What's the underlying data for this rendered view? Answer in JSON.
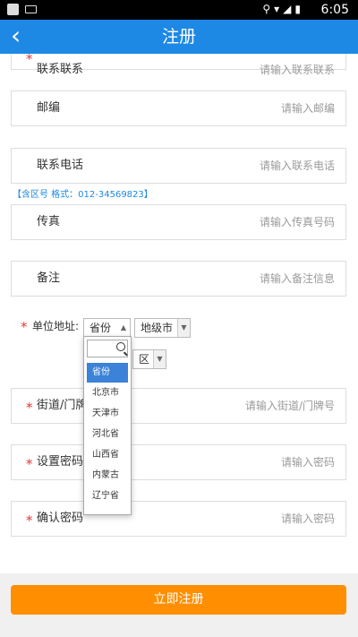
{
  "status_bar": {
    "time": "6:05"
  },
  "app_bar": {
    "back_icon": "chevron-left-icon",
    "title": "注册"
  },
  "form": {
    "top_cut_label": "联系联系",
    "top_cut_placeholder": "请输入联系联系",
    "postcode": {
      "label": "邮编",
      "placeholder": "请输入邮编"
    },
    "phone": {
      "label": "联系电话",
      "placeholder": "请输入联系电话"
    },
    "phone_hint": "【含区号 格式：012-34569823】",
    "fax": {
      "label": "传真",
      "placeholder": "请输入传真号码"
    },
    "remark": {
      "label": "备注",
      "placeholder": "请输入备注信息"
    },
    "address": {
      "label": "单位地址:",
      "province_select": "省份",
      "city_select": "地级市",
      "district_select": "区",
      "province_options": [
        "省份",
        "北京市",
        "天津市",
        "河北省",
        "山西省",
        "内蒙古",
        "辽宁省"
      ]
    },
    "street": {
      "label": "街道/门牌",
      "placeholder": "请输入街道/门牌号"
    },
    "password": {
      "label": "设置密码",
      "placeholder": "请输入密码"
    },
    "confirm_password": {
      "label": "确认密码",
      "placeholder": "请输入密码"
    },
    "required_mark": "*"
  },
  "submit_label": "立即注册"
}
